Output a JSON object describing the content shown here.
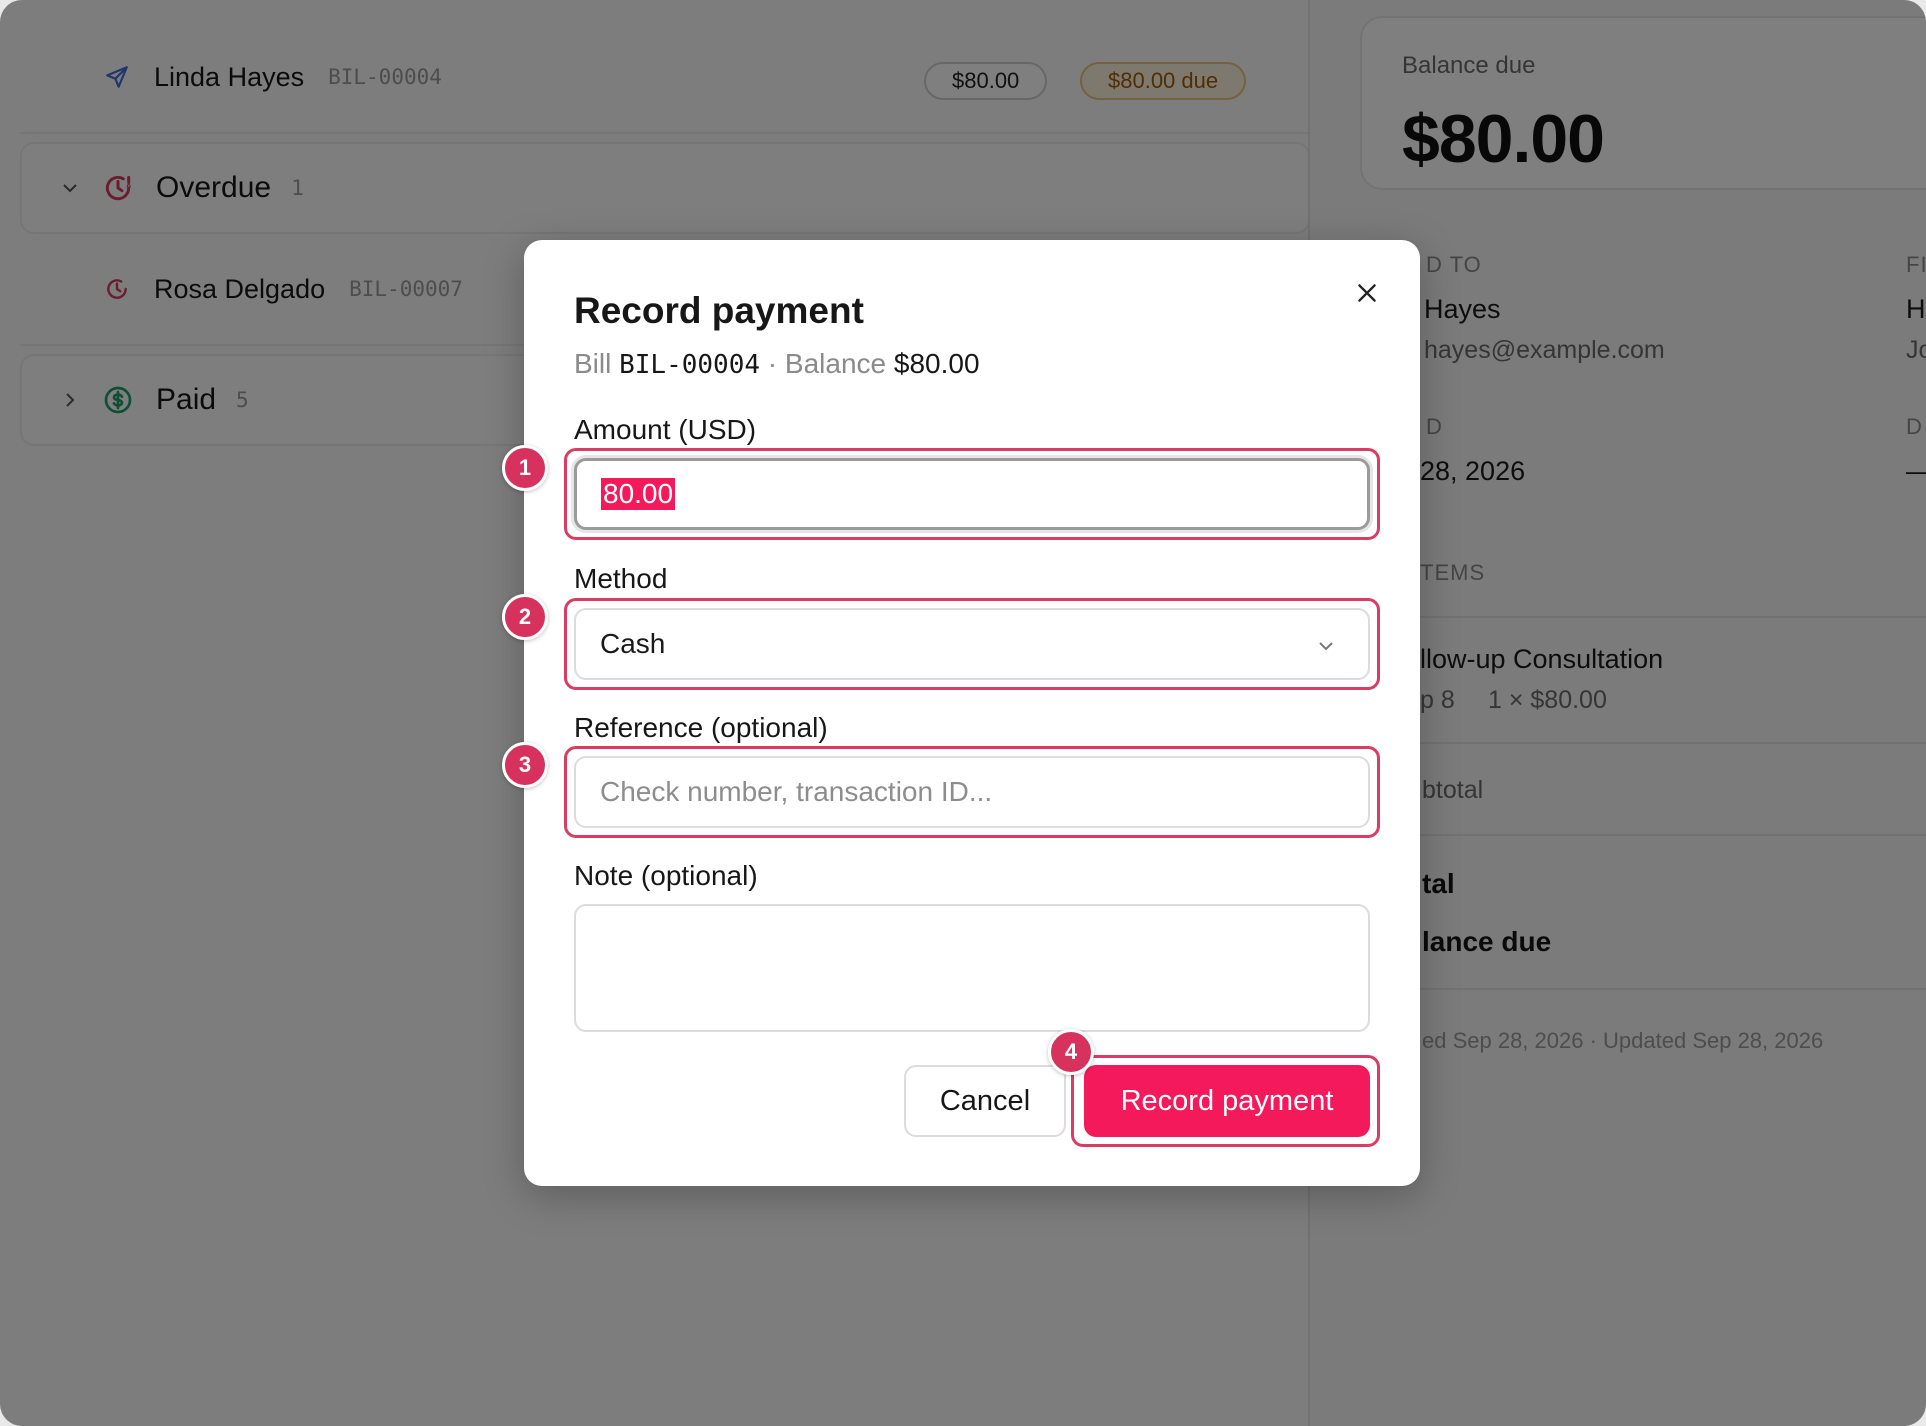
{
  "list": {
    "rows": [
      {
        "name": "Linda Hayes",
        "id": "BIL-00004",
        "amount": "$80.00",
        "due": "$80.00 due"
      },
      {
        "name": "Rosa Delgado",
        "id": "BIL-00007"
      }
    ],
    "groups": [
      {
        "title": "Overdue",
        "count": "1"
      },
      {
        "title": "Paid",
        "count": "5"
      }
    ]
  },
  "detail": {
    "balance_label": "Balance due",
    "balance_amount": "$80.00",
    "billed_to_label": "D TO",
    "billed_to_name": "Hayes",
    "billed_to_email": "hayes@example.com",
    "issued_label": "D",
    "issued_value": "28, 2026",
    "right_label_1": "FI",
    "right_value_1": "H",
    "right_sub_1": "Jo",
    "right_label_2": "D",
    "right_value_2": "—",
    "items_label": "TEMS",
    "item_name": "llow-up Consultation",
    "item_date": "p 8",
    "item_qty": "1 × $80.00",
    "subtotal_label": "btotal",
    "total_label": "tal",
    "balance_due_label": "lance due",
    "footer": "ed Sep 28, 2026 · Updated Sep 28, 2026"
  },
  "modal": {
    "title": "Record payment",
    "sub_bill_prefix": "Bill",
    "sub_bill_id": "BIL-00004",
    "sub_separator": "·",
    "sub_balance_prefix": "Balance",
    "sub_balance_value": "$80.00",
    "amount_label": "Amount (USD)",
    "amount_value": "80.00",
    "method_label": "Method",
    "method_value": "Cash",
    "reference_label": "Reference (optional)",
    "reference_placeholder": "Check number, transaction ID...",
    "note_label": "Note (optional)",
    "cancel_label": "Cancel",
    "submit_label": "Record payment"
  },
  "annotations": [
    "1",
    "2",
    "3",
    "4"
  ],
  "colors": {
    "accent": "#f3195a",
    "annotation": "#d93d63",
    "overdue": "#d23b5c",
    "paid": "#1f9d6b",
    "sent": "#3b6fd6"
  }
}
